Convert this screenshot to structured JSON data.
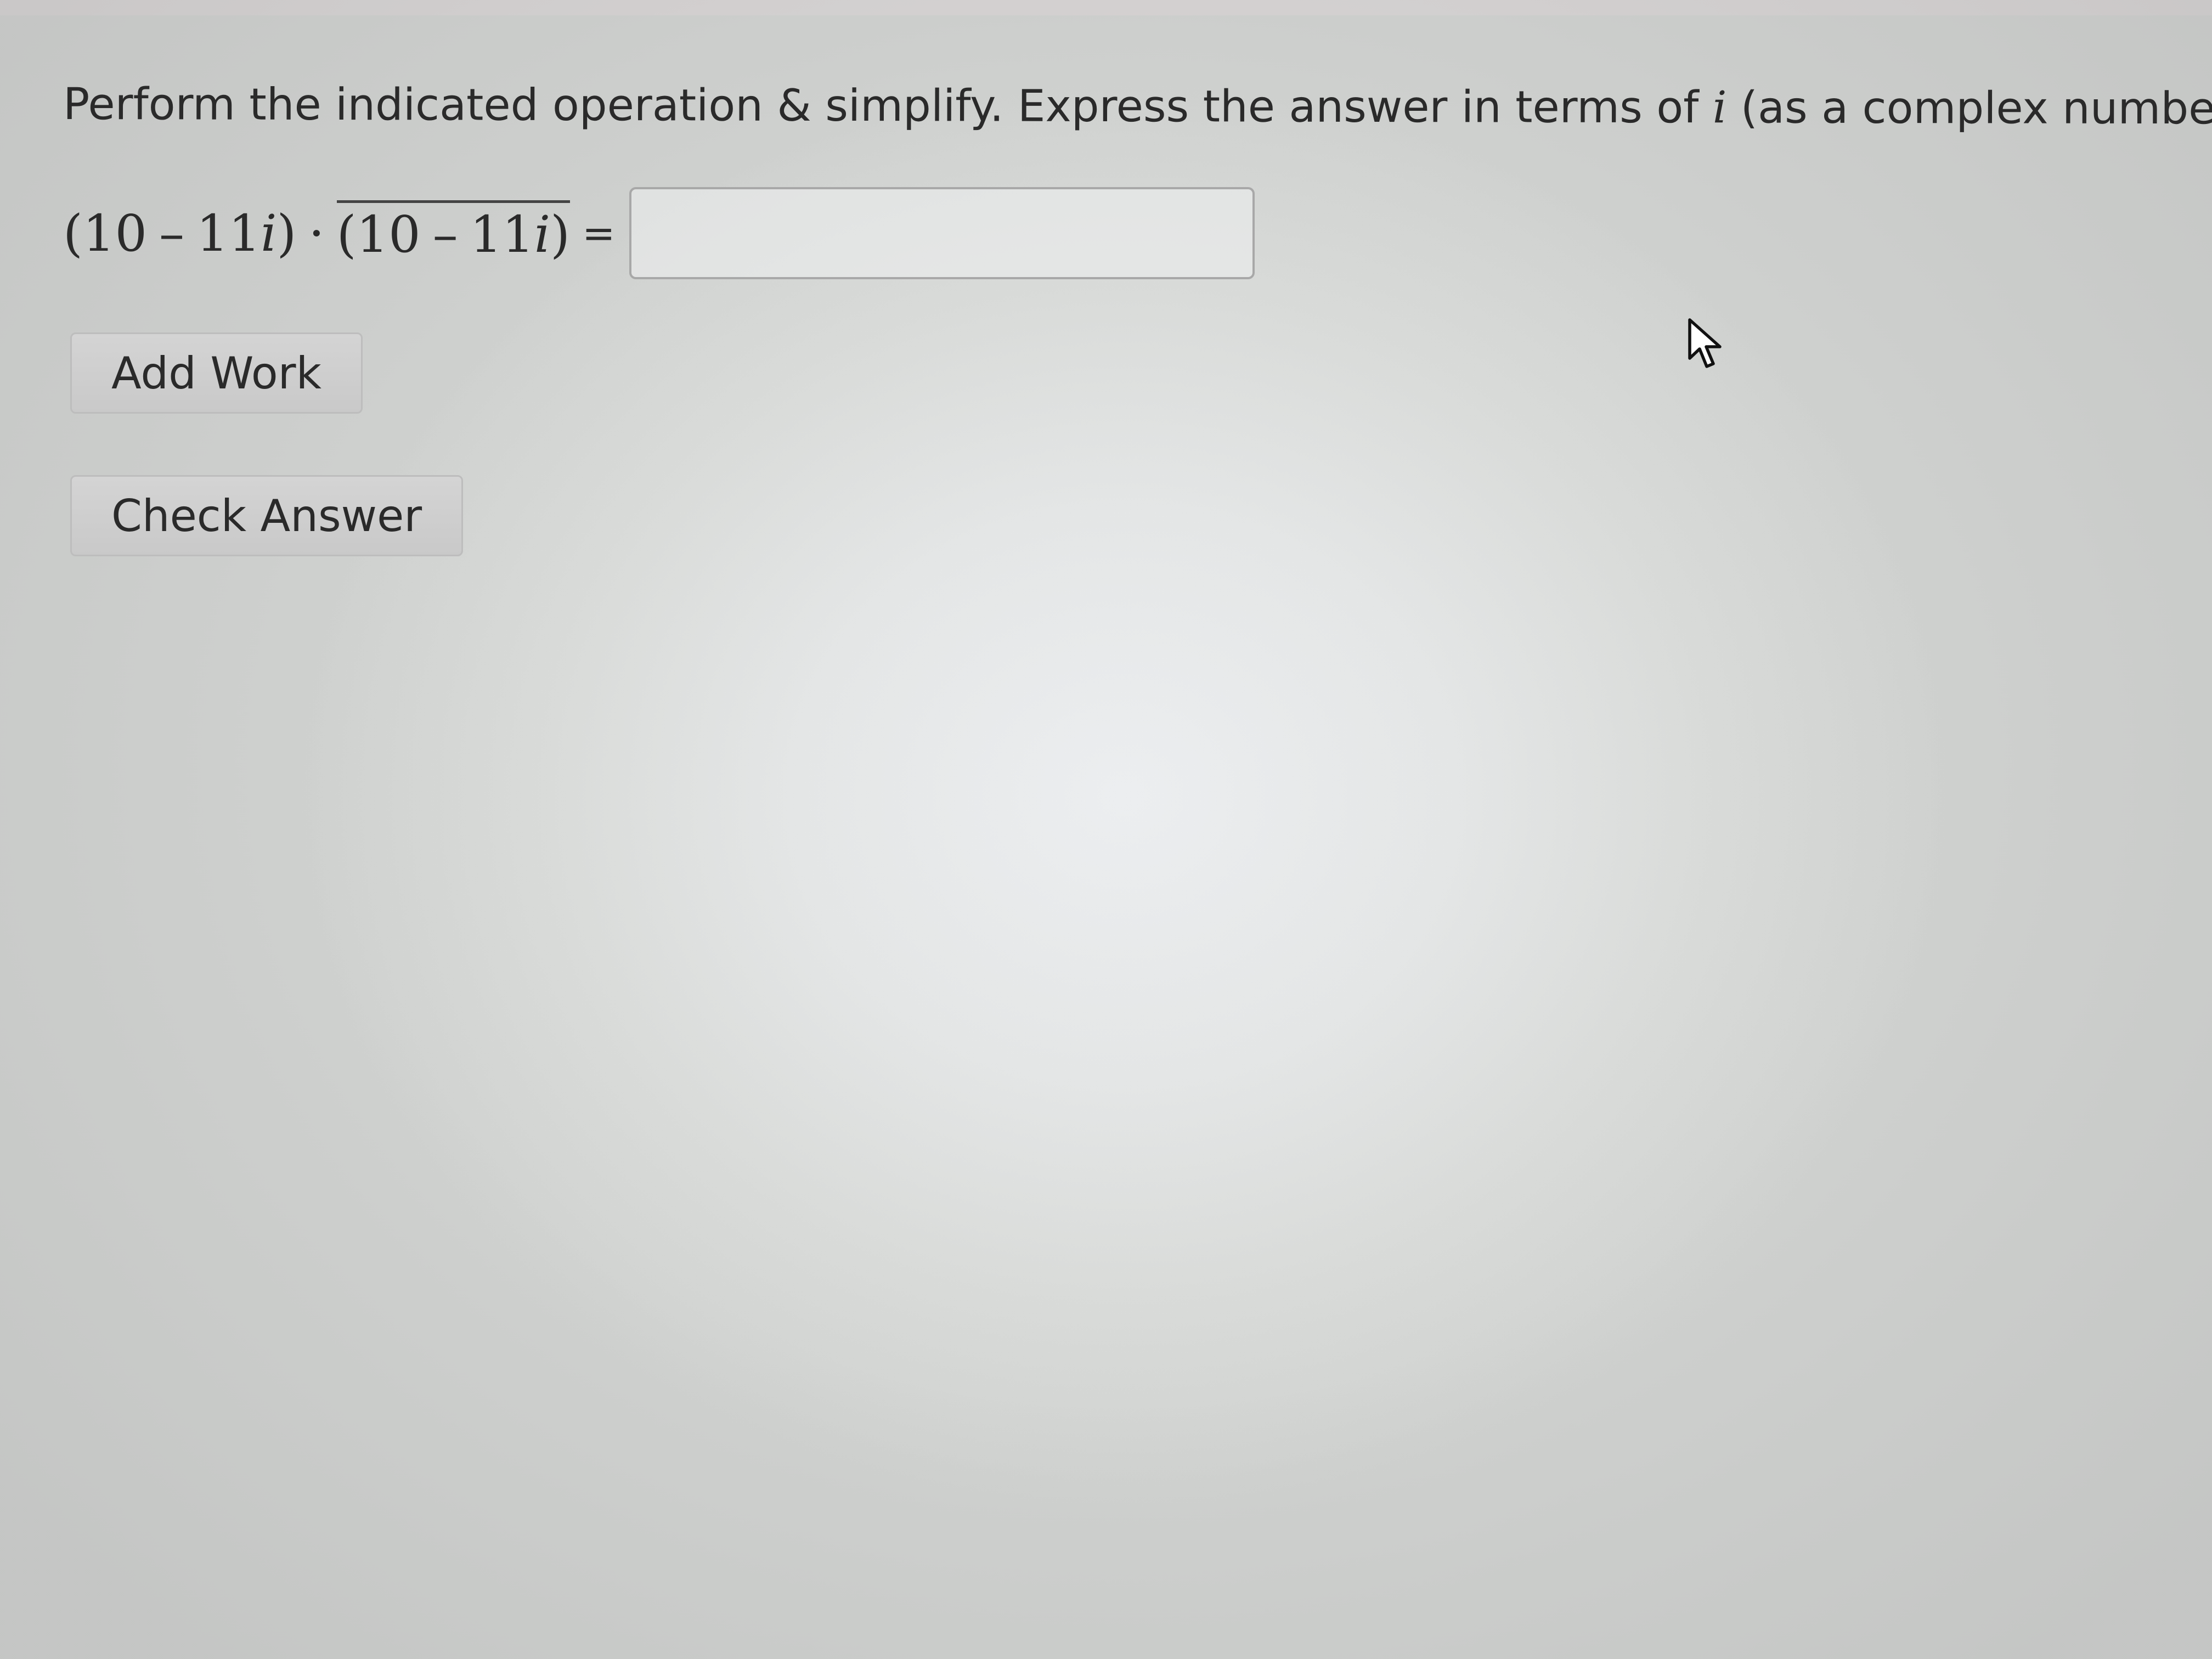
{
  "question": {
    "instruction_before_var": "Perform the indicated operation & simplify. Express the answer in terms of ",
    "instruction_var": "i",
    "instruction_after_var": " (as a complex number)."
  },
  "equation": {
    "left_paren": "(",
    "left_real": "10",
    "left_minus": "–",
    "left_imag_coeff": "11",
    "left_imag_unit": "i",
    "left_close_paren": ")",
    "dot": "·",
    "conj_open": "(",
    "conj_real": "10",
    "conj_minus": "–",
    "conj_imag_coeff": "11",
    "conj_imag_unit": "i",
    "conj_close": ")",
    "equals": "="
  },
  "answer_input": {
    "value": "",
    "placeholder": ""
  },
  "buttons": {
    "add_work_label": "Add Work",
    "check_answer_label": "Check Answer"
  },
  "cursor": {
    "icon": "arrow-pointer-icon"
  },
  "colors": {
    "text": "#2a2a2a",
    "button_bg": "#cfcfcf",
    "input_border": "#a8a8a8",
    "page_bg": "#e4e6e6"
  }
}
